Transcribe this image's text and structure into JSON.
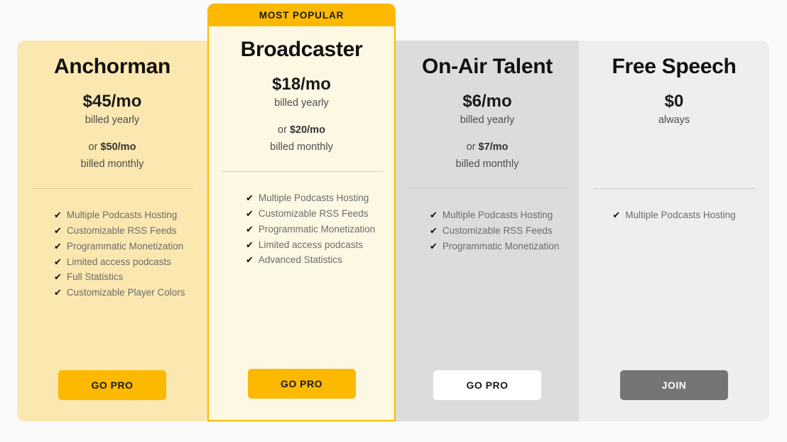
{
  "plans": [
    {
      "id": "anchorman",
      "name": "Anchorman",
      "price_main": "$45/mo",
      "price_sub": "billed yearly",
      "alt_prefix": "or ",
      "alt_price": "$50/mo",
      "alt_sub": "billed monthly",
      "features": [
        "Multiple Podcasts Hosting",
        "Customizable RSS Feeds",
        "Programmatic Monetization",
        "Limited access podcasts",
        "Full Statistics",
        "Customizable Player Colors"
      ],
      "cta_label": "GO PRO",
      "bg_color": "#fbe8b0",
      "cta_color": "#fcb900"
    },
    {
      "id": "broadcaster",
      "badge": "MOST POPULAR",
      "name": "Broadcaster",
      "price_main": "$18/mo",
      "price_sub": "billed yearly",
      "alt_prefix": "or ",
      "alt_price": "$20/mo",
      "alt_sub": "billed monthly",
      "features": [
        "Multiple Podcasts Hosting",
        "Customizable RSS Feeds",
        "Programmatic Monetization",
        "Limited access podcasts",
        "Advanced Statistics"
      ],
      "cta_label": "GO PRO",
      "bg_color": "#fdf8e3",
      "border_color": "#fcb900",
      "cta_color": "#fcb900"
    },
    {
      "id": "on-air-talent",
      "name": "On-Air Talent",
      "price_main": "$6/mo",
      "price_sub": "billed yearly",
      "alt_prefix": "or ",
      "alt_price": "$7/mo",
      "alt_sub": "billed monthly",
      "features": [
        "Multiple Podcasts Hosting",
        "Customizable RSS Feeds",
        "Programmatic Monetization"
      ],
      "cta_label": "GO PRO",
      "bg_color": "#dcdcdc",
      "cta_color": "#ffffff"
    },
    {
      "id": "free-speech",
      "name": "Free Speech",
      "price_main": "$0",
      "price_sub": "always",
      "features": [
        "Multiple Podcasts Hosting"
      ],
      "cta_label": "JOIN",
      "bg_color": "#eeeeee",
      "cta_color": "#757575"
    }
  ],
  "icons": {
    "check": "✔"
  }
}
